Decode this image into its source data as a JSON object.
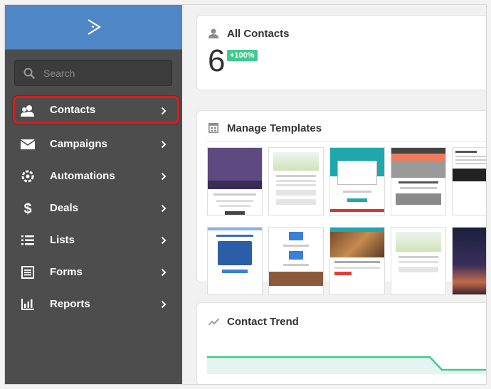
{
  "search": {
    "placeholder": "Search"
  },
  "sidebar": {
    "items": [
      {
        "label": "Contacts",
        "icon": "contacts-icon"
      },
      {
        "label": "Campaigns",
        "icon": "envelope-icon"
      },
      {
        "label": "Automations",
        "icon": "automation-gear-icon"
      },
      {
        "label": "Deals",
        "icon": "dollar-icon"
      },
      {
        "label": "Lists",
        "icon": "list-icon"
      },
      {
        "label": "Forms",
        "icon": "form-icon"
      },
      {
        "label": "Reports",
        "icon": "bar-chart-icon"
      }
    ]
  },
  "all_contacts": {
    "title": "All Contacts",
    "count": "6",
    "change": "+100%"
  },
  "templates": {
    "title": "Manage Templates"
  },
  "trend": {
    "title": "Contact Trend"
  },
  "colors": {
    "sidebar": "#4d4d4d",
    "logo_bar": "#4f86c5",
    "accent_green": "#3fca8f",
    "active_outline": "#e01b1b"
  }
}
